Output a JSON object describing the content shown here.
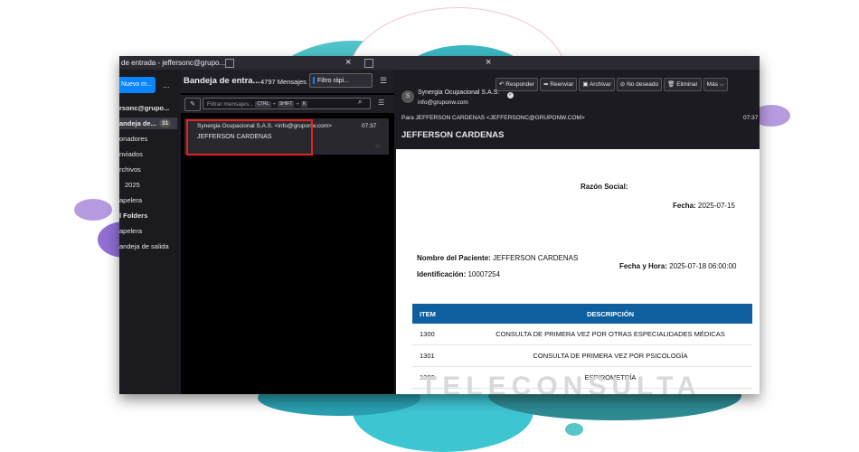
{
  "colors": {
    "accent": "#0a84ff",
    "table_header": "#0d5fa0",
    "highlight_box": "#e02424",
    "bg_dark": "#1c1b22"
  },
  "titlebar": {
    "title": "de entrada - jeffersonc@grupo...",
    "close": "×"
  },
  "sidebar": {
    "new_button": "Nuevo m...",
    "more": "...",
    "account": "rsonc@grupo...",
    "folders": [
      {
        "label": "andeja de...",
        "badge": "31"
      },
      {
        "label": "onadores"
      },
      {
        "label": "nviados"
      },
      {
        "label": "rchivos"
      },
      {
        "label": "2025"
      },
      {
        "label": "apelera"
      },
      {
        "label": "l Folders"
      },
      {
        "label": "apelera"
      },
      {
        "label": "andeja de salida"
      }
    ]
  },
  "list": {
    "title": "Bandeja de entra...",
    "count": "4797 Mensajes",
    "quick_filter": "Filtro rápi...",
    "filter_placeholder": "Filtrar mensajes...",
    "kbd_ctrl": "CTRL",
    "kbd_shift": "SHIFT",
    "kbd_k": "K",
    "plus": "+",
    "messages": [
      {
        "from": "Synergia Ocupacional S.A.S. <info@gruponw.com>",
        "time": "07:37",
        "subject": "JEFFERSON CARDENAS"
      }
    ]
  },
  "reader": {
    "toolbar": {
      "reply": "Responder",
      "forward": "Reenviar",
      "archive": "Archivar",
      "junk": "No deseado",
      "delete": "Eliminar",
      "more": "Más"
    },
    "sender_name": "Synergia Ocupacional S.A.S.",
    "sender_email": "info@gruponw.com",
    "to_label": "Para",
    "to": "JEFFERSON CARDENAS <JEFFERSONC@GRUPONW.COM>",
    "time": "07:37",
    "subject": "JEFFERSON CARDENAS",
    "body": {
      "razon_social_label": "Razón Social:",
      "fecha_label": "Fecha:",
      "fecha_value": "2025-07-15",
      "paciente_label": "Nombre del Paciente:",
      "paciente_value": "JEFFERSON CARDENAS",
      "ident_label": "Identificación:",
      "ident_value": "10007254",
      "fecha_hora_label": "Fecha y Hora:",
      "fecha_hora_value": "2025-07-18 06:00:00",
      "table_headers": [
        "ITEM",
        "DESCRIPCIÓN"
      ],
      "rows": [
        {
          "item": "1300",
          "desc": "CONSULTA DE PRIMERA VEZ POR OTRAS ESPECIALIDADES MÉDICAS"
        },
        {
          "item": "1301",
          "desc": "CONSULTA DE PRIMERA VEZ POR PSICOLOGÍA"
        },
        {
          "item": "1302",
          "desc": "ESPIROMETRÍA"
        }
      ],
      "watermark": "TELECONSULTA"
    }
  }
}
